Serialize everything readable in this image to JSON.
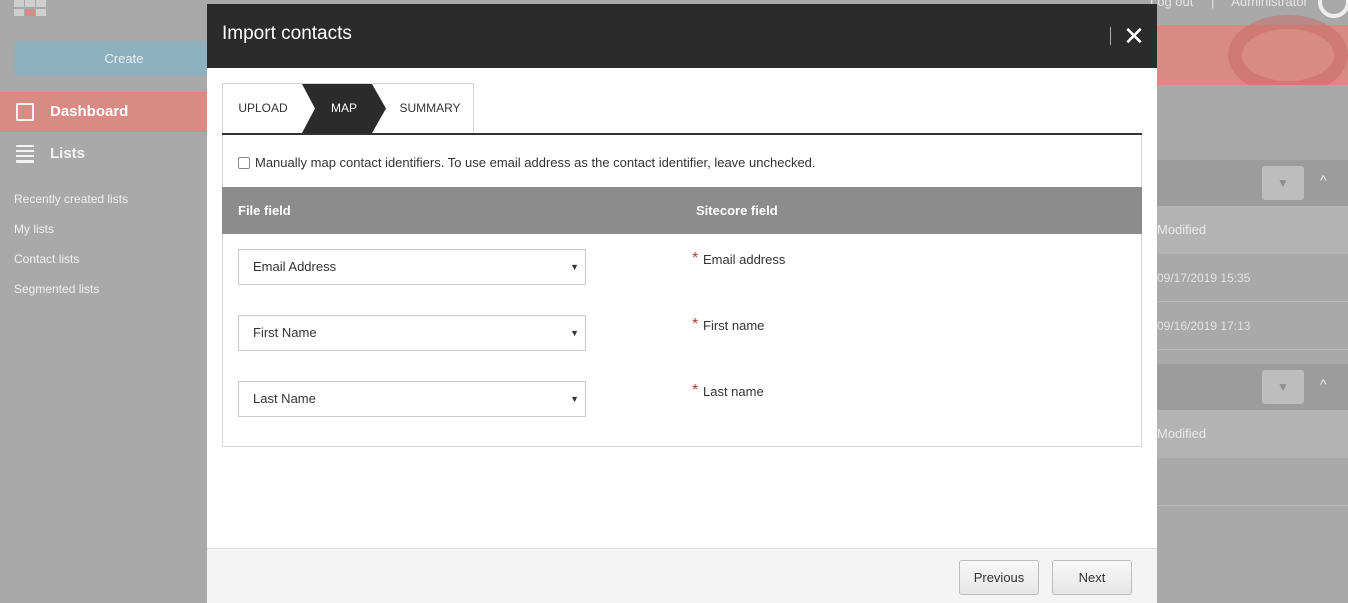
{
  "background": {
    "header": {
      "logout_label": "Log out",
      "separator": "|",
      "user_name": "Administrator"
    },
    "sidebar": {
      "create_label": "Create",
      "nav": [
        {
          "label": "Dashboard",
          "icon": "presentation-board-icon",
          "active": true
        },
        {
          "label": "Lists",
          "icon": "list-icon",
          "active": false
        }
      ],
      "links": [
        "Recently created lists",
        "My lists",
        "Contact lists",
        "Segmented lists"
      ]
    },
    "right_panel": {
      "sections": [
        {
          "column_header": "Modified",
          "rows": [
            "09/17/2019 15:35",
            "09/16/2019 17:13"
          ]
        },
        {
          "column_header": "Modified",
          "rows": []
        }
      ],
      "dropdown_icon": "▼",
      "collapse_icon": "^"
    }
  },
  "modal": {
    "title": "Import contacts",
    "close_icon": "✕",
    "steps": [
      {
        "label": "UPLOAD",
        "active": false
      },
      {
        "label": "MAP",
        "active": true
      },
      {
        "label": "SUMMARY",
        "active": false
      }
    ],
    "checkbox": {
      "label": "Manually map contact identifiers. To use email address as the contact identifier, leave unchecked.",
      "checked": false
    },
    "table": {
      "headers": {
        "file_field": "File field",
        "sitecore_field": "Sitecore field"
      },
      "rows": [
        {
          "file_field": "Email Address",
          "required_marker": "*",
          "sitecore_field": "Email address"
        },
        {
          "file_field": "First Name",
          "required_marker": "*",
          "sitecore_field": "First name"
        },
        {
          "file_field": "Last Name",
          "required_marker": "*",
          "sitecore_field": "Last name"
        }
      ]
    },
    "footer": {
      "previous_label": "Previous",
      "next_label": "Next"
    }
  },
  "colors": {
    "modal_header_bg": "#2b2b2b",
    "active_step_bg": "#2b2b2b",
    "table_header_bg": "#8c8c8c",
    "required_color": "#c0392b",
    "overlay_gray": "#a9a9a9",
    "accent_red": "#d98a84"
  }
}
